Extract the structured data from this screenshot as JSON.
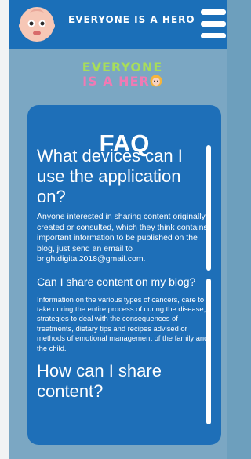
{
  "header": {
    "title": "EVERYONE IS A HERO",
    "avatar_icon": "baby-face-icon",
    "menu_icon": "hamburger-menu-icon",
    "background": "#1b6fb8"
  },
  "logo": {
    "line1": "EVERYONE",
    "line2": "IS A HER",
    "colors": {
      "line1": "#a8dd5a",
      "line2": "#f07ab4"
    }
  },
  "faq": {
    "title": "FAQ",
    "items": [
      {
        "question": "What devices can I use the application on?",
        "answer": "Anyone interested in sharing content originally created or consulted, which they think contains important information to be published on the blog, just send an email to brightdigital2018@gmail.com."
      },
      {
        "question": "Can I share content on my blog?",
        "answer": "Information on the various types of cancers, care to take during the entire process of curing the disease, strategies to deal with the consequences of treatments, dietary tips and recipes advised or methods of emotional management of the family and the child."
      },
      {
        "question": "How can I share content?",
        "answer": ""
      }
    ]
  }
}
